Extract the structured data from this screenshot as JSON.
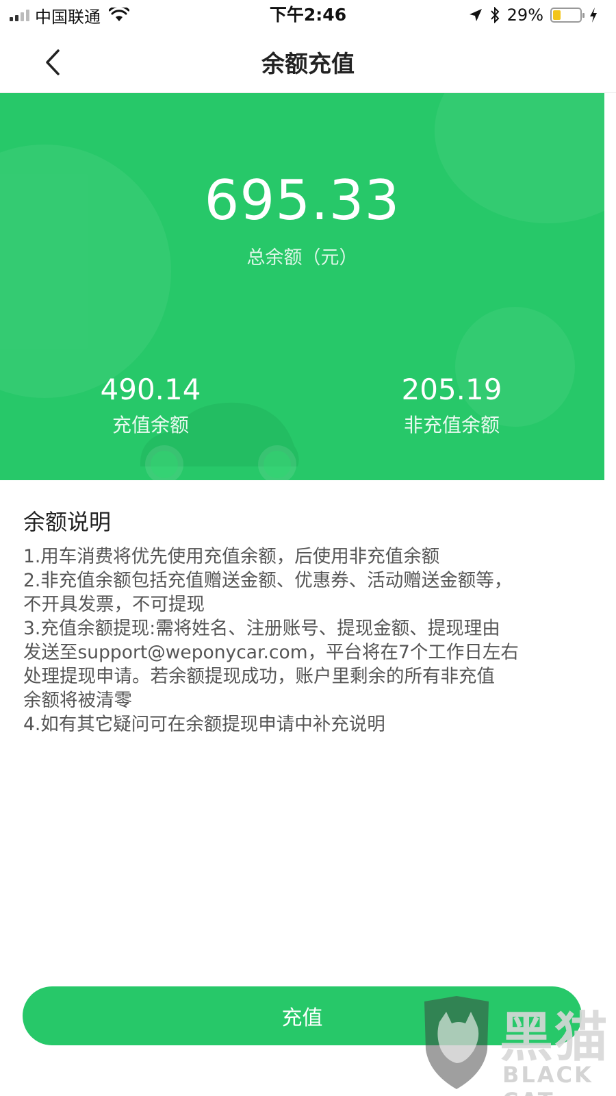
{
  "status_bar": {
    "carrier": "中国联通",
    "time": "下午2:46",
    "battery_percent": "29%",
    "battery_level": 0.29,
    "icons": [
      "signal-icon",
      "wifi-icon",
      "location-icon",
      "bluetooth-icon",
      "battery-icon",
      "charging-icon"
    ]
  },
  "nav": {
    "title": "余额充值",
    "back_icon": "chevron-left-icon"
  },
  "balance": {
    "total_value": "695.33",
    "total_label": "总余额（元）",
    "recharge_value": "490.14",
    "recharge_label": "充值余额",
    "non_recharge_value": "205.19",
    "non_recharge_label": "非充值余额",
    "hero_color": "#27c869"
  },
  "description": {
    "title": "余额说明",
    "lines": [
      "1.用车消费将优先使用充值余额，后使用非充值余额",
      "2.非充值余额包括充值赠送金额、优惠券、活动赠送金额等，",
      "不开具发票，不可提现",
      "3.充值余额提现:需将姓名、注册账号、提现金额、提现理由",
      "发送至support@weponycar.com，平台将在7个工作日左右",
      "处理提现申请。若余额提现成功，账户里剩余的所有非充值",
      "余额将被清零",
      "4.如有其它疑问可在余额提现申请中补充说明"
    ]
  },
  "action": {
    "recharge_label": "充值"
  },
  "watermark": {
    "text_cn": "黑猫",
    "text_en": "BLACK CAT"
  }
}
